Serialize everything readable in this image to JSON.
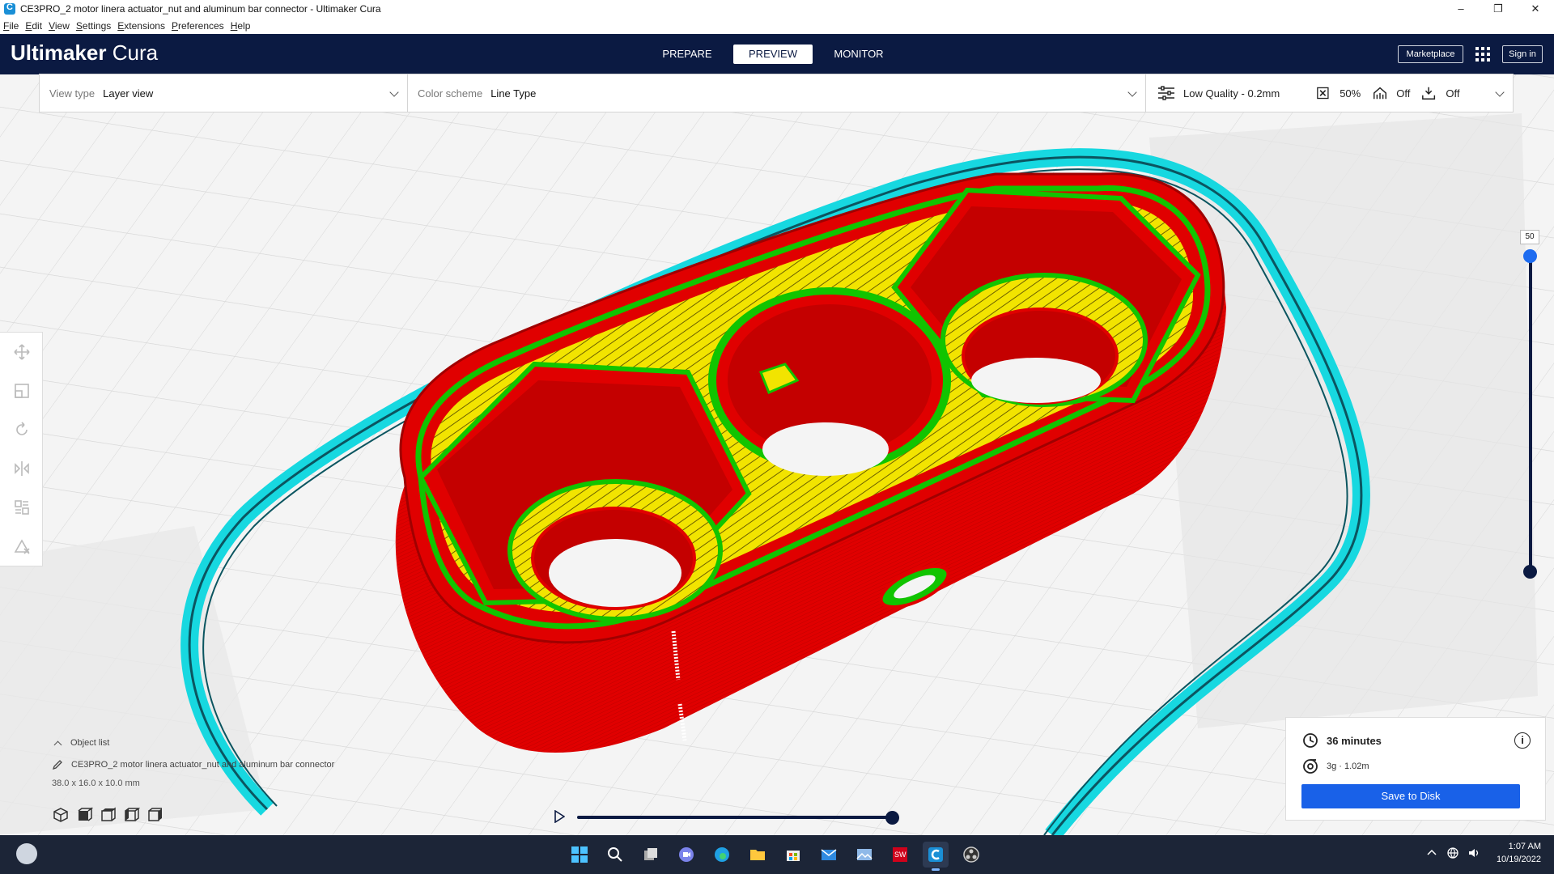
{
  "window": {
    "title": "CE3PRO_2 motor linera actuator_nut and aluminum bar connector - Ultimaker Cura",
    "controls": [
      "–",
      "❐",
      "✕"
    ]
  },
  "menu": [
    "File",
    "Edit",
    "View",
    "Settings",
    "Extensions",
    "Preferences",
    "Help"
  ],
  "header": {
    "logo_bold": "Ultimaker",
    "logo_light": " Cura",
    "tabs": [
      {
        "label": "PREPARE",
        "active": false
      },
      {
        "label": "PREVIEW",
        "active": true
      },
      {
        "label": "MONITOR",
        "active": false
      }
    ],
    "marketplace_label": "Marketplace",
    "signin_label": "Sign in"
  },
  "toolbar": {
    "view_type_label": "View type",
    "view_type_value": "Layer view",
    "color_scheme_label": "Color scheme",
    "color_scheme_value": "Line Type",
    "quality": "Low Quality - 0.2mm",
    "infill": "50%",
    "support": "Off",
    "adhesion": "Off"
  },
  "layer_slider": {
    "current_layer": "50",
    "fraction": 1.0
  },
  "object_list": {
    "header": "Object list",
    "object_name": "CE3PRO_2 motor linera actuator_nut and aluminum bar connector",
    "dimensions": "38.0 x 16.0 x 10.0 mm"
  },
  "scrubber": {
    "fraction": 1.0
  },
  "print_info": {
    "time": "36 minutes",
    "material": "3g · 1.02m",
    "save_label": "Save to Disk"
  },
  "taskbar": {
    "time": "1:07 AM",
    "date": "10/19/2022",
    "apps": [
      "windows-start",
      "search",
      "task-view",
      "teams-chat",
      "edge",
      "file-explorer",
      "microsoft-store",
      "mail",
      "photos",
      "solidworks",
      "cura",
      "obs"
    ]
  },
  "colors": {
    "header_bg": "#0b1a42",
    "accent": "#1961e8",
    "wall_red": "#e00000",
    "infill_yellow": "#f2e400",
    "inner_wall_green": "#11c400",
    "skirt_cyan": "#17d8e0"
  }
}
